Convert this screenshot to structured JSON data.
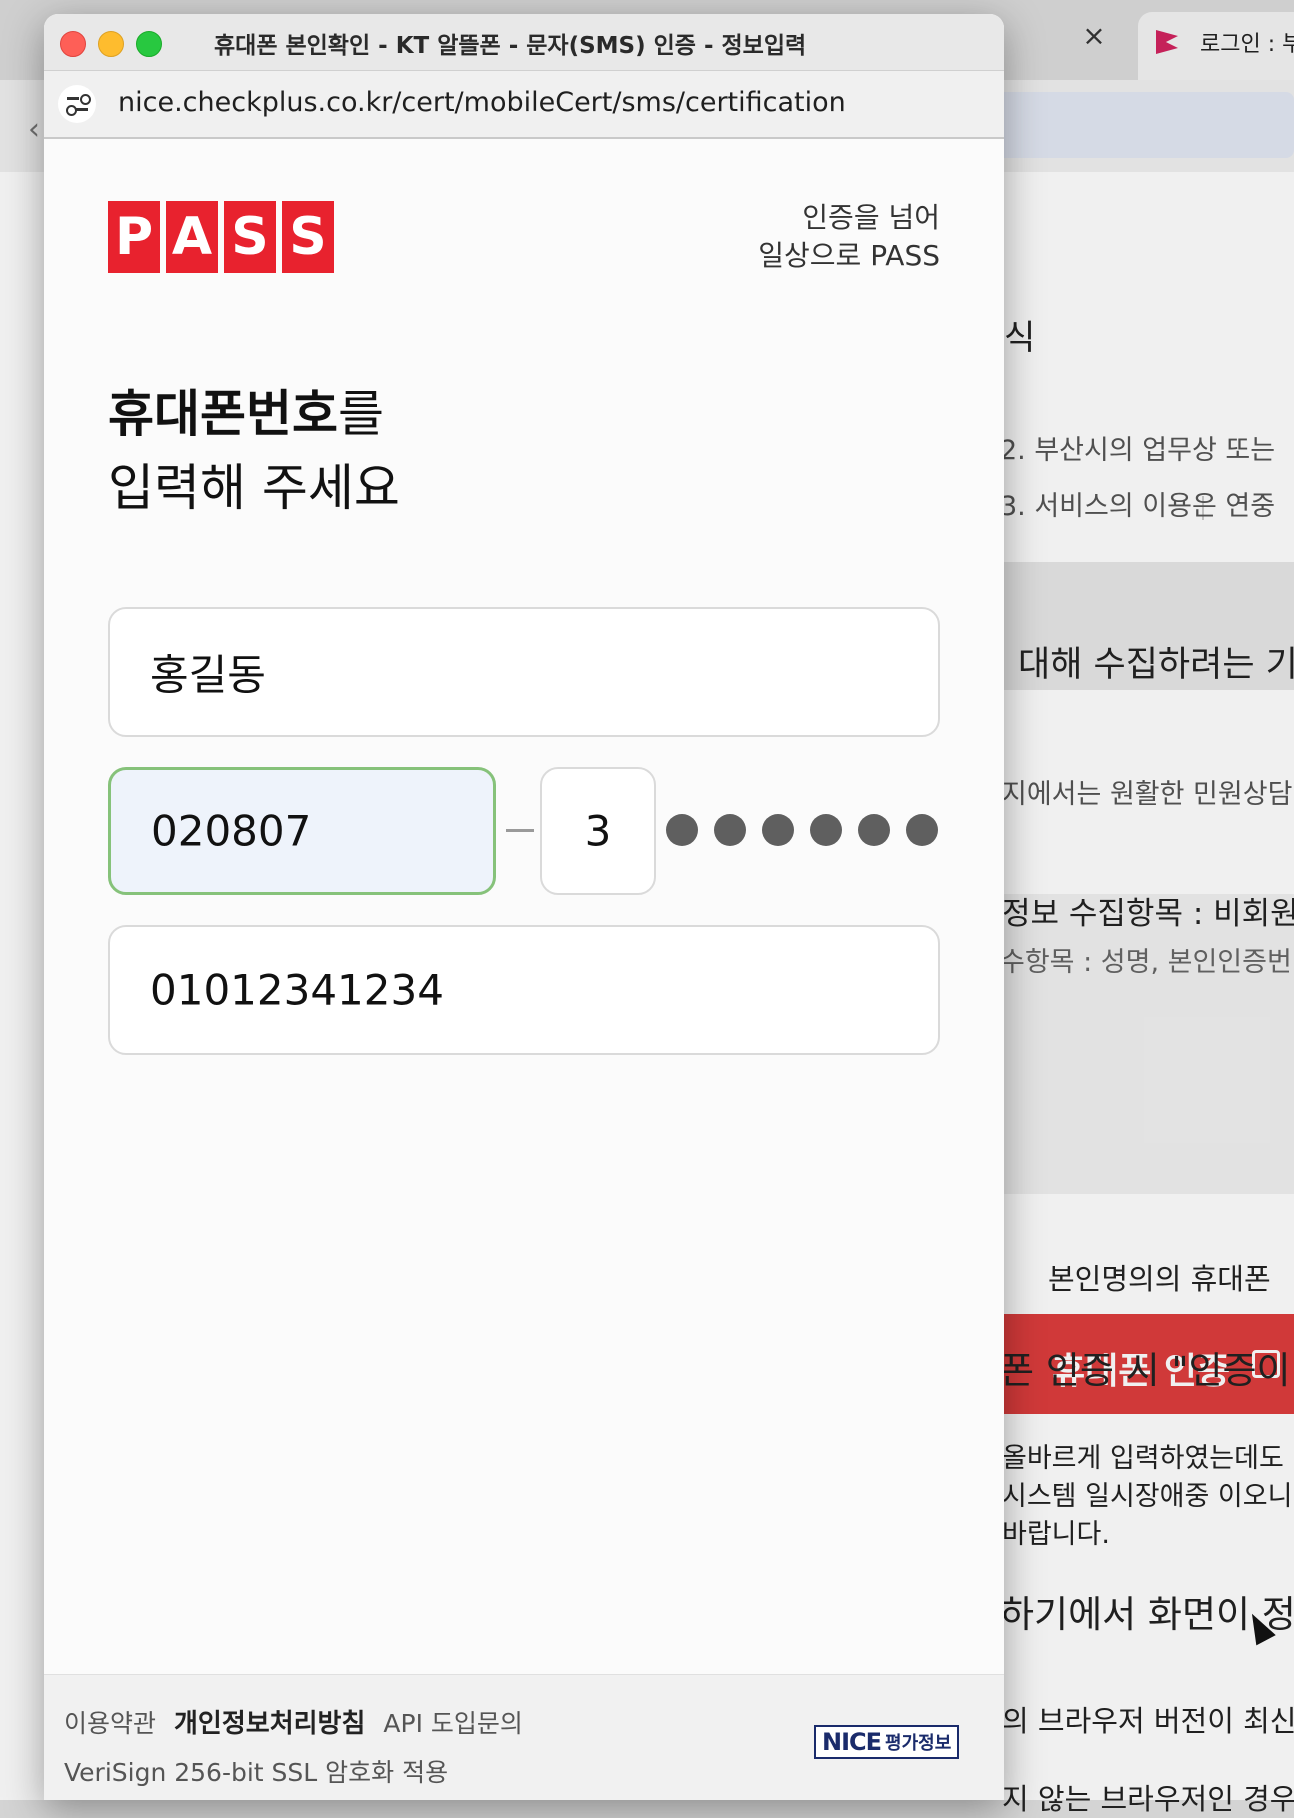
{
  "background_browser": {
    "tab_close": "×",
    "tab_title": "로그인 : 부",
    "page_lines": [
      "식",
      "2. 부산시의 업무상 또는",
      "3. 서비스의 이용은 연중",
      "대해 수집하려는 기",
      "지에서는 원활한 민원상담",
      "정보 수집항목 : 비회원",
      "수항목 : 성명, 본인인증번",
      "본인명의의 휴대폰",
      "폰 인증 시 \"인증이 실",
      "올바르게 입력하였는데도",
      "시스템 일시장애중 이오니",
      "바랍니다.",
      "하기에서 화면이 정상",
      "의 브라우저 버전이 최신",
      "지 않는 브라우저인 경우"
    ],
    "cert_button": "휴대폰 인증"
  },
  "popup": {
    "window_title": "휴대폰 본인확인 - KT 알뜰폰 - 문자(SMS) 인증 - 정보입력",
    "url": "nice.checkplus.co.kr/cert/mobileCert/sms/certification",
    "logo_letters": [
      "P",
      "A",
      "S",
      "S"
    ],
    "slogan_line1": "인증을 넘어",
    "slogan_line2": "일상으로 PASS",
    "heading_bold": "휴대폰번호",
    "heading_rest": "를",
    "heading_line2": "입력해 주세요",
    "name_value": "홍길동",
    "birth_value": "020807",
    "gender_value": "3",
    "phone_value": "01012341234",
    "footer": {
      "terms": "이용약관",
      "privacy": "개인정보처리방침",
      "api": "API 도입문의",
      "ssl": "VeriSign 256-bit SSL 암호화 적용",
      "nice_brand": "NICE",
      "nice_sub": "평가정보"
    }
  },
  "colors": {
    "pass_red": "#e8222e",
    "focus_green": "#86c27a",
    "focus_fill": "#eef3fb",
    "cert_button_red": "#dd3d3d"
  }
}
